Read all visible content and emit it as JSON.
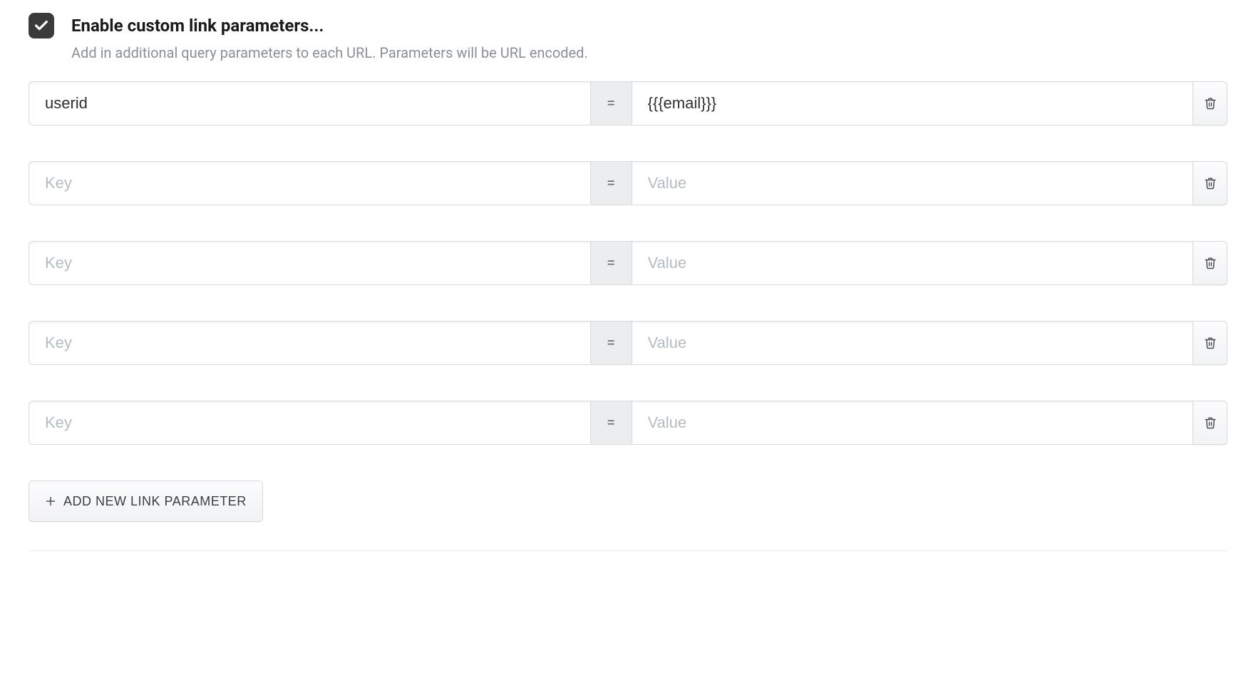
{
  "header": {
    "title": "Enable custom link parameters...",
    "description": "Add in additional query parameters to each URL. Parameters will be URL encoded.",
    "checkbox_checked": true
  },
  "placeholders": {
    "key": "Key",
    "value": "Value"
  },
  "equals": "=",
  "rows": [
    {
      "key": "userid",
      "value": "{{{email}}}"
    },
    {
      "key": "",
      "value": ""
    },
    {
      "key": "",
      "value": ""
    },
    {
      "key": "",
      "value": ""
    },
    {
      "key": "",
      "value": ""
    }
  ],
  "add_button_label": "ADD NEW LINK PARAMETER"
}
